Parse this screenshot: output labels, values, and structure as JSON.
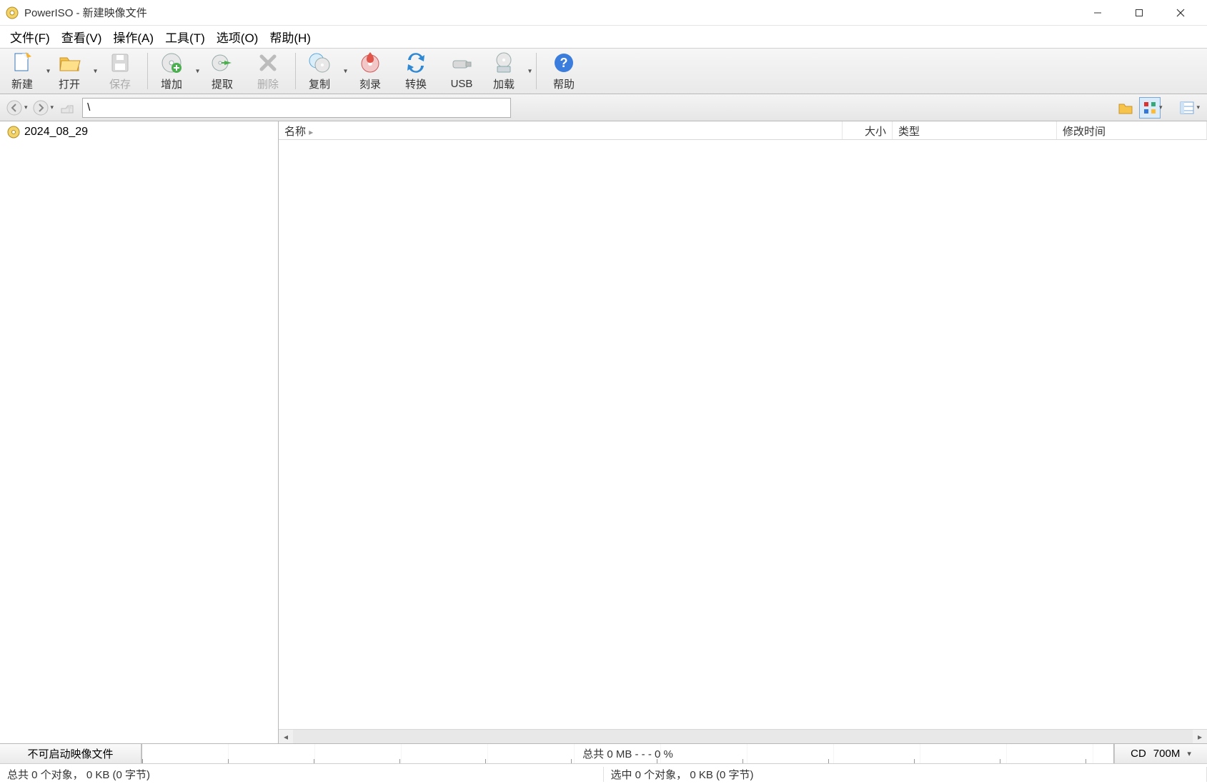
{
  "window": {
    "title": "PowerISO - 新建映像文件"
  },
  "menubar": [
    "文件(F)",
    "查看(V)",
    "操作(A)",
    "工具(T)",
    "选项(O)",
    "帮助(H)"
  ],
  "toolbar": {
    "new": "新建",
    "open": "打开",
    "save": "保存",
    "add": "增加",
    "extract": "提取",
    "delete": "删除",
    "copy": "复制",
    "burn": "刻录",
    "convert": "转换",
    "usb": "USB",
    "mount": "加载",
    "help": "帮助"
  },
  "path_input": "\\",
  "tree": {
    "root_label": "2024_08_29"
  },
  "columns": {
    "name": "名称",
    "size": "大小",
    "type": "类型",
    "modified": "修改时间"
  },
  "boot_label": "不可启动映像文件",
  "capacity_text": "总共 0 MB  - - -  0 %",
  "media": {
    "type": "CD",
    "size": "700M"
  },
  "status": {
    "total": "总共 0 个对象， 0 KB (0 字节)",
    "selected": "选中 0 个对象， 0 KB (0 字节)"
  }
}
